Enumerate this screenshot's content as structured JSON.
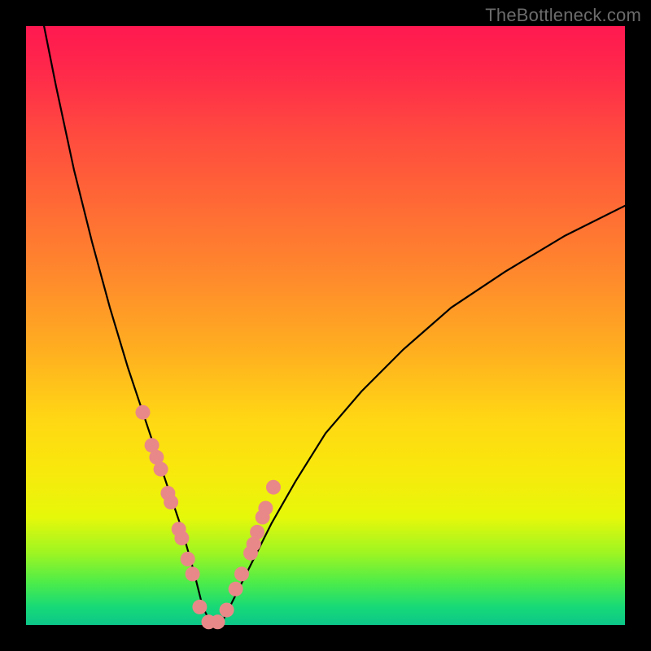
{
  "watermark": "TheBottleneck.com",
  "colors": {
    "frame": "#000000",
    "gradient": [
      "#ff1850",
      "#ff2a4a",
      "#ff4a3f",
      "#ff6a35",
      "#ff8a2c",
      "#ffae20",
      "#ffd814",
      "#f9e80c",
      "#e6f80a",
      "#9ef522",
      "#4cec4a",
      "#17d977",
      "#0cc789"
    ],
    "curve_stroke": "#000000",
    "dot_fill": "#e98888"
  },
  "chart_data": {
    "type": "line",
    "title": "",
    "xlabel": "",
    "ylabel": "",
    "xlim": [
      0,
      100
    ],
    "ylim": [
      0,
      100
    ],
    "grid": false,
    "legend": false,
    "annotations": [],
    "note": "Bottleneck-style V-curve. Minimum at x≈31, y≈0. Left branch rises steeply toward y=100 at x≈3; right branch rises gradually reaching y≈70 at x=100. Axis numeric values are estimated since no tick labels are shown.",
    "series": [
      {
        "name": "bottleneck_curve",
        "x": [
          3,
          5,
          8,
          11,
          14,
          17,
          20,
          22,
          24,
          26,
          28,
          29.5,
          31,
          33,
          35,
          38,
          41,
          45,
          50,
          56,
          63,
          71,
          80,
          90,
          100
        ],
        "y": [
          100,
          90,
          76,
          64,
          53,
          43,
          34,
          28,
          22,
          16,
          9,
          3,
          0,
          1,
          5,
          11,
          17,
          24,
          32,
          39,
          46,
          53,
          59,
          65,
          70
        ]
      }
    ],
    "points_overlay": {
      "name": "highlight_dots",
      "note": "Salmon dots clustered on both flanks near the valley.",
      "x": [
        19.5,
        21.0,
        21.8,
        22.5,
        23.7,
        24.2,
        25.5,
        26.0,
        27.0,
        27.8,
        29.0,
        30.5,
        32.0,
        33.5,
        35.0,
        36.0,
        37.5,
        38.0,
        38.6,
        39.5,
        40.0,
        41.3
      ],
      "y": [
        35.5,
        30.0,
        28.0,
        26.0,
        22.0,
        20.5,
        16.0,
        14.5,
        11.0,
        8.5,
        3.0,
        0.5,
        0.5,
        2.5,
        6.0,
        8.5,
        12.0,
        13.5,
        15.5,
        18.0,
        19.5,
        23.0
      ]
    }
  }
}
